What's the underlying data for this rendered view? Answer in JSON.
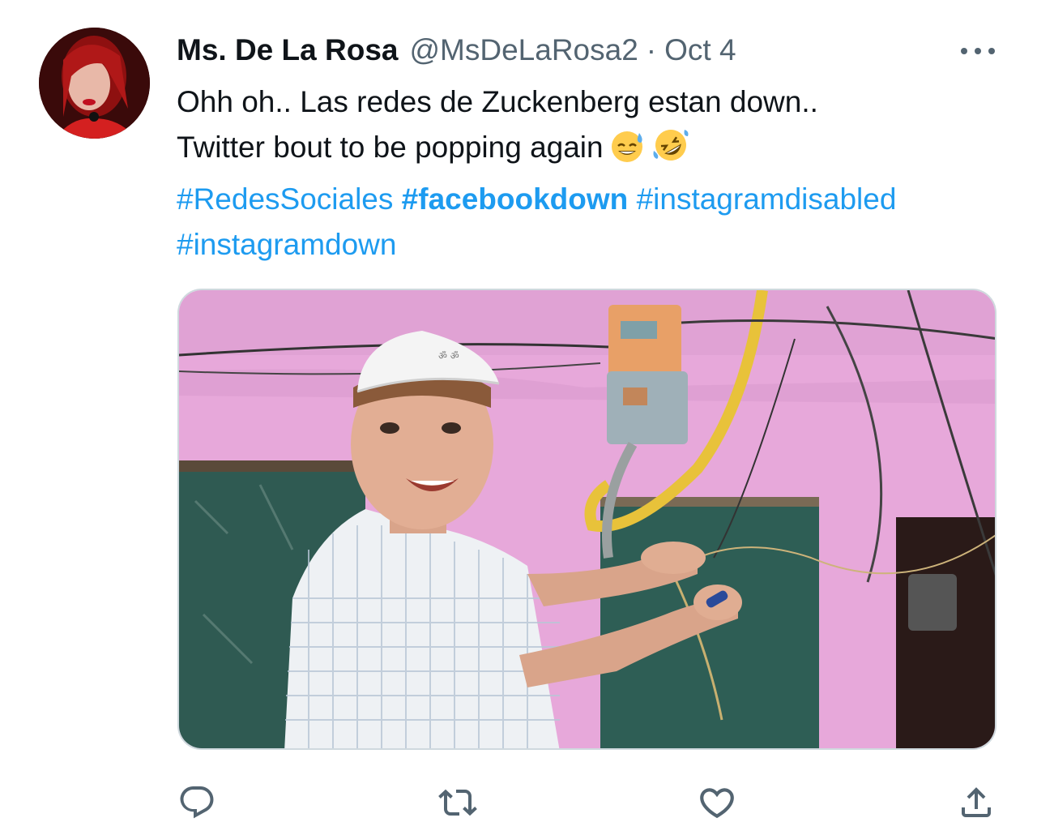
{
  "tweet": {
    "author_name": "Ms. De La Rosa",
    "handle": "@MsDeLaRosa2",
    "separator": "·",
    "date": "Oct 4",
    "text_line1": "Ohh oh.. Las redes de Zuckenberg estan down..",
    "text_line2": "Twitter bout to be popping again",
    "emojis": [
      "😅",
      "🤣"
    ],
    "hashtags": [
      "#RedesSociales",
      "#facebookdown",
      "#instagramdisabled",
      "#instagramdown"
    ],
    "bold_hashtag": "#facebookdown"
  },
  "icons": {
    "more": "more-horizontal-icon",
    "reply": "reply-icon",
    "retweet": "retweet-icon",
    "like": "heart-icon",
    "share": "share-icon"
  },
  "colors": {
    "link": "#1d9bf0",
    "secondary": "#536471",
    "text": "#0f1419",
    "wall": "#e7a8da"
  }
}
